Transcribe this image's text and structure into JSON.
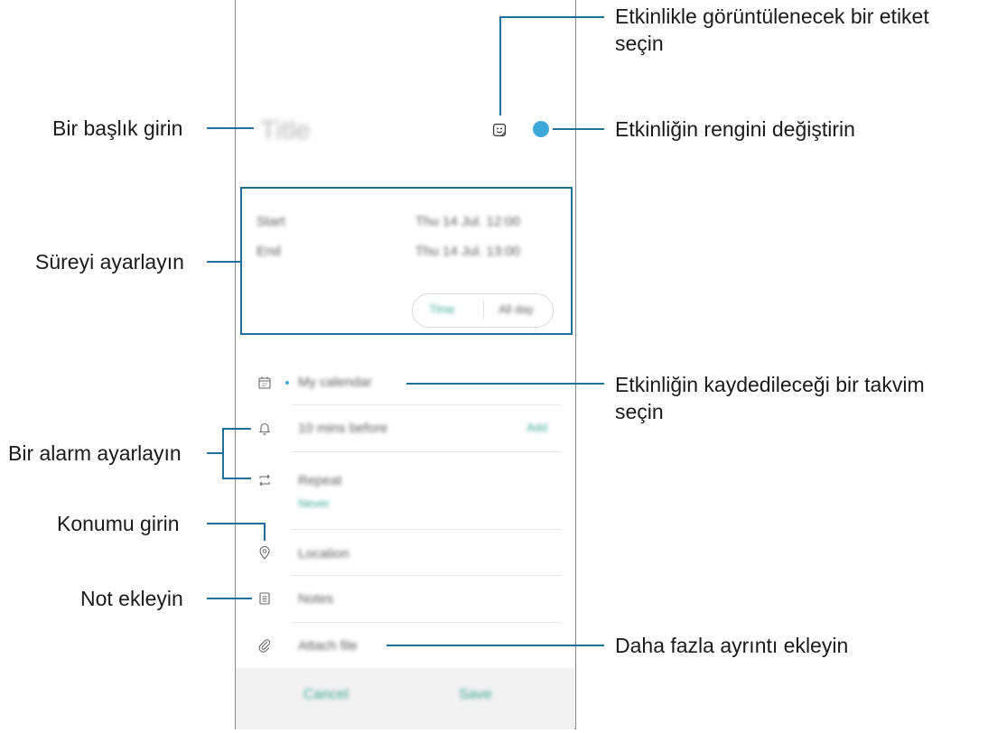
{
  "callouts": {
    "sticker": [
      "Etkinlikle görüntülenecek bir etiket",
      "seçin"
    ],
    "title": "Bir başlık girin",
    "color": "Etkinliğin rengini değiştirin",
    "duration": "Süreyi ayarlayın",
    "calendar": [
      "Etkinliğin kaydedileceği bir takvim",
      "seçin"
    ],
    "alarm": "Bir alarm ayarlayın",
    "location": "Konumu girin",
    "note": "Not ekleyin",
    "details": "Daha fazla ayrıntı ekleyin"
  },
  "form": {
    "title_placeholder": "Title",
    "start_label": "Start",
    "start_value": "Thu 14 Jul. 12:00",
    "end_label": "End",
    "end_value": "Thu 14 Jul. 13:00",
    "toggle_left": "Time",
    "toggle_right": "All day",
    "calendar_value": "My calendar",
    "alarm_value": "10 mins before",
    "alarm_badge": "Add",
    "repeat_label": "Repeat",
    "repeat_value": "Never",
    "location_placeholder": "Location",
    "notes_placeholder": "Notes",
    "attach_label": "Attach file",
    "cancel": "Cancel",
    "save": "Save"
  },
  "colors": {
    "accent": "#1f6f9a",
    "event_color": "#3da9d8",
    "teal_text": "#3aa890"
  }
}
